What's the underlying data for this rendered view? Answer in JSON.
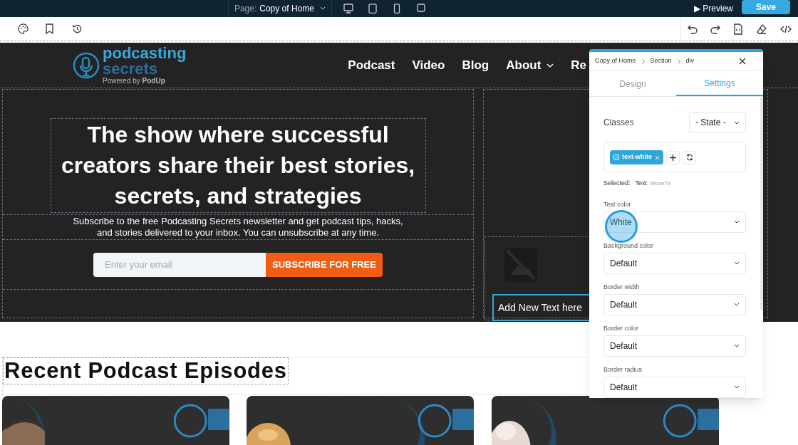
{
  "topbar": {
    "page_label": "Page:",
    "page_name": "Copy of Home",
    "devices": [
      {
        "kind": "desktop"
      },
      {
        "kind": "tablet"
      },
      {
        "kind": "phone"
      },
      {
        "kind": "square"
      }
    ],
    "preview": "▶ Preview",
    "save": "Save"
  },
  "site": {
    "logo_top": "podcasting",
    "logo_bottom": "secrets",
    "powered": "Powered by **PodUp**",
    "nav": [
      {
        "label": "Podcast",
        "dropdown": false
      },
      {
        "label": "Video",
        "dropdown": false
      },
      {
        "label": "Blog",
        "dropdown": false
      },
      {
        "label": "About",
        "dropdown": true
      },
      {
        "label": "Re",
        "dropdown": false
      }
    ],
    "hero_title": "The show where successful creators share their best stories, secrets, and strategies",
    "hero_text": "Subscribe to the free Podcasting Secrets newsletter and get podcast tips, hacks, and stories delivered to your inbox. You can unsubscribe at any time.",
    "email_placeholder": "Enter your email",
    "subscribe": "SUBSCRIBE FOR FREE",
    "side_text": "Add New Text here",
    "episodes_title": "Recent Podcast Episodes"
  },
  "panel": {
    "breadcrumb": [
      "Copy of Home",
      "Section",
      "div"
    ],
    "tabs": [
      {
        "label": "Design",
        "selected": false
      },
      {
        "label": "Settings",
        "selected": true
      }
    ],
    "classes_label": "Classes",
    "state_select": "- State -",
    "class_tag": "text-white",
    "selected_label": "Selected:",
    "selected_type": "Text",
    "selected_id": "#ikxw79",
    "fields": [
      {
        "label": "Text color",
        "value": "White"
      },
      {
        "label": "Background color",
        "value": "Default"
      },
      {
        "label": "Border width",
        "value": "Default"
      },
      {
        "label": "Border color",
        "value": "Default"
      },
      {
        "label": "Border radius",
        "value": "Default"
      }
    ]
  }
}
